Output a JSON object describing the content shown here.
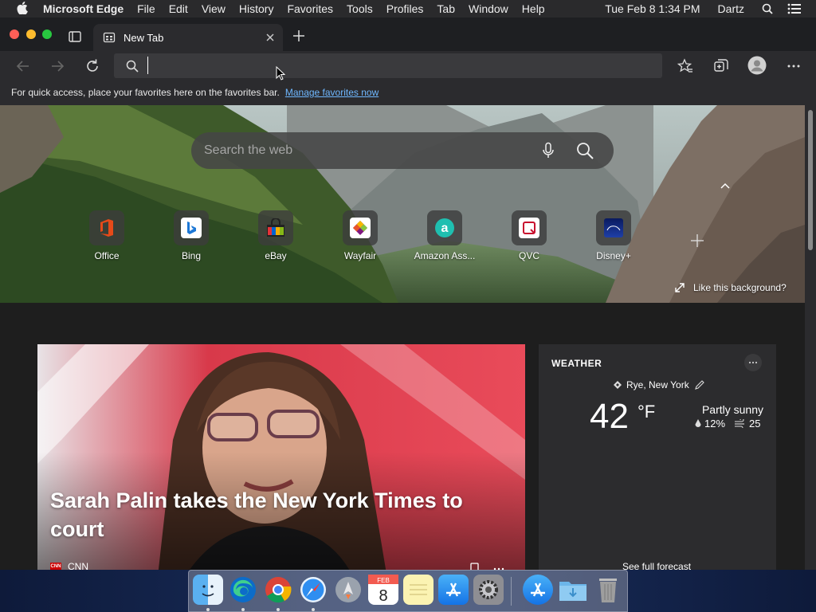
{
  "menubar": {
    "app_name": "Microsoft Edge",
    "menus": [
      "File",
      "Edit",
      "View",
      "History",
      "Favorites",
      "Tools",
      "Profiles",
      "Tab",
      "Window",
      "Help"
    ],
    "clock": "Tue Feb 8  1:34 PM",
    "user": "Dartz"
  },
  "tab": {
    "title": "New Tab"
  },
  "address": {
    "value": ""
  },
  "favorites_bar": {
    "message": "For quick access, place your favorites here on the favorites bar.",
    "link": "Manage favorites now"
  },
  "search": {
    "placeholder": "Search the web"
  },
  "quick_links": [
    {
      "label": "Office"
    },
    {
      "label": "Bing"
    },
    {
      "label": "eBay"
    },
    {
      "label": "Wayfair"
    },
    {
      "label": "Amazon Ass..."
    },
    {
      "label": "QVC"
    },
    {
      "label": "Disney+"
    }
  ],
  "background": {
    "like_text": "Like this background?"
  },
  "news": {
    "headline": "Sarah Palin takes the New York Times to court",
    "source": "CNN",
    "source_badge": "CNN"
  },
  "weather": {
    "header": "WEATHER",
    "location": "Rye, New York",
    "temperature": "42",
    "unit": "°F",
    "condition": "Partly sunny",
    "precip": "12%",
    "wind": "25",
    "forecast_link": "See full forecast"
  },
  "dock": {
    "calendar_month": "FEB",
    "calendar_day": "8"
  },
  "colors": {
    "accent_link": "#6fb8ff",
    "tab_bg": "#2b2b2e",
    "news_bg": "#d9302f"
  }
}
